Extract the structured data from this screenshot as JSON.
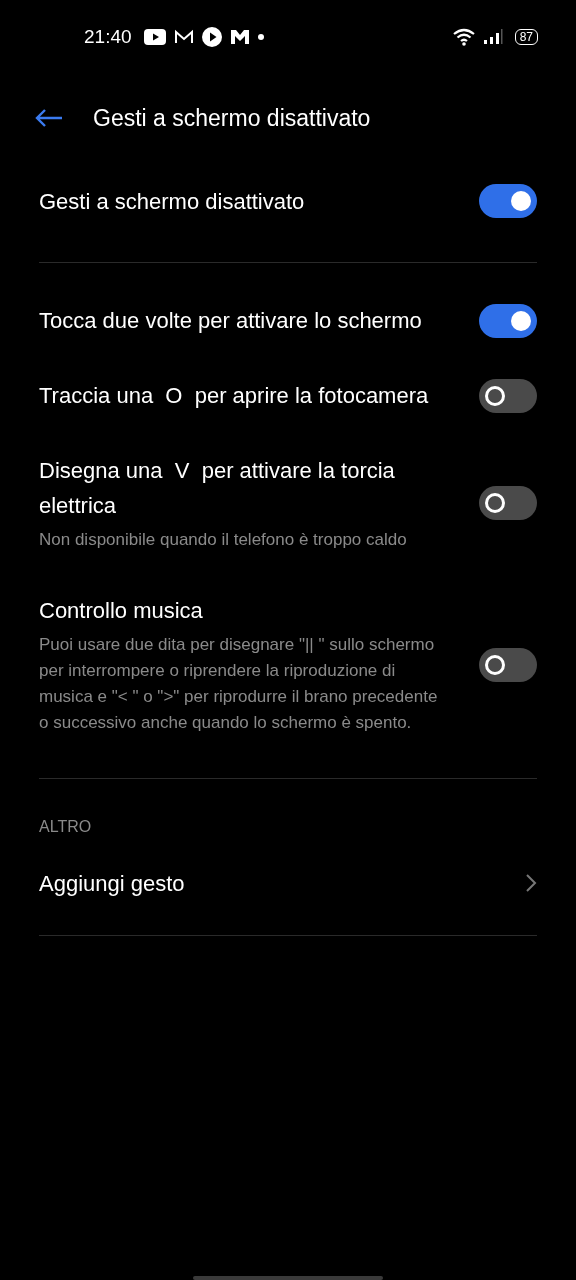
{
  "status_bar": {
    "time": "21:40",
    "battery": "87"
  },
  "header": {
    "title": "Gesti a schermo disattivato"
  },
  "main_toggle": {
    "label": "Gesti a schermo disattivato",
    "on": true
  },
  "gestures": [
    {
      "label": "Tocca due volte per attivare lo schermo",
      "on": true
    },
    {
      "label": "Traccia una  O  per aprire la fotocamera",
      "on": false
    },
    {
      "label": "Disegna una  V  per attivare la torcia elettrica",
      "description": "Non disponibile quando il telefono è troppo caldo",
      "on": false
    },
    {
      "label": "Controllo musica",
      "description": "Puoi usare due dita per disegnare \"|| \" sullo schermo per interrompere o riprendere la riproduzione di musica e \"< \" o \">\" per riprodurre il brano precedente o successivo anche quando lo schermo è spento.",
      "on": false
    }
  ],
  "section": {
    "heading": "ALTRO",
    "items": [
      {
        "label": "Aggiungi gesto"
      }
    ]
  }
}
